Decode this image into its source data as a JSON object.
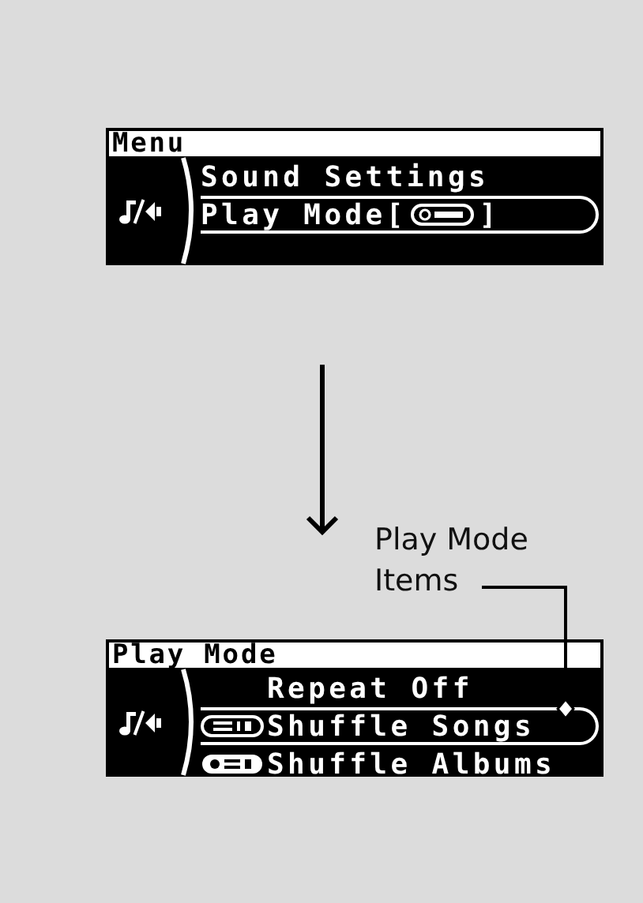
{
  "displays": [
    {
      "title": "Menu",
      "rows": [
        {
          "kind": "text",
          "label": "Sound Settings",
          "selected": false
        },
        {
          "kind": "inline-badge",
          "label": "Play Mode[",
          "badge": {
            "kind": "dial"
          },
          "after": "]",
          "selected": true
        }
      ]
    },
    {
      "title": "Play Mode",
      "rows": [
        {
          "kind": "lead-badge",
          "label": "Repeat Off",
          "selected": false
        },
        {
          "kind": "lead-badge",
          "badge": {
            "kind": "songs"
          },
          "label": "Shuffle Songs",
          "selected": true
        },
        {
          "kind": "lead-badge",
          "badge": {
            "kind": "albums"
          },
          "label": "Shuffle Albums",
          "selected": false
        }
      ]
    }
  ],
  "callout": {
    "label": "Play Mode Items"
  }
}
